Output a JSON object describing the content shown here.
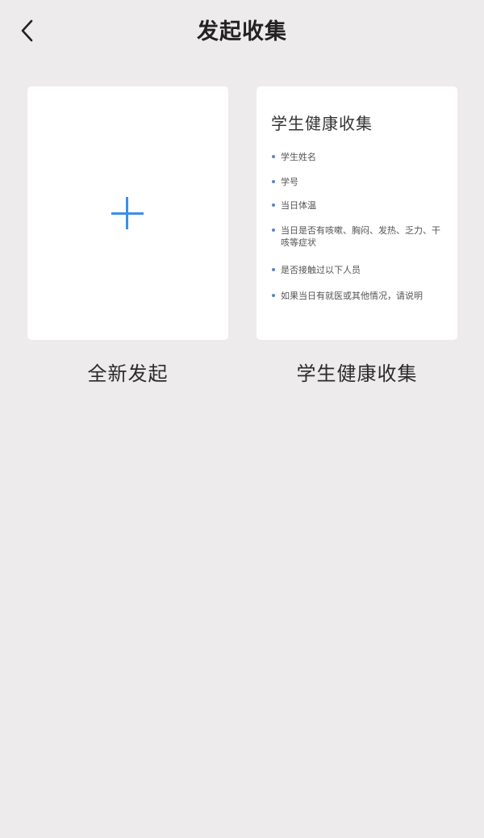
{
  "header": {
    "back_icon": "chevron-left-icon",
    "title": "发起收集"
  },
  "cards": {
    "new": {
      "icon": "plus-icon",
      "icon_color": "#3b8fe6",
      "label": "全新发起"
    },
    "template": {
      "title": "学生健康收集",
      "items": [
        "学生姓名",
        "学号",
        "当日体温",
        "当日是否有咳嗽、胸闷、发热、乏力、干咳等症状",
        "是否接触过以下人员",
        "如果当日有就医或其他情况，请说明"
      ],
      "label": "学生健康收集"
    }
  },
  "colors": {
    "background": "#edebec",
    "card": "#ffffff",
    "accent": "#3b8fe6"
  }
}
